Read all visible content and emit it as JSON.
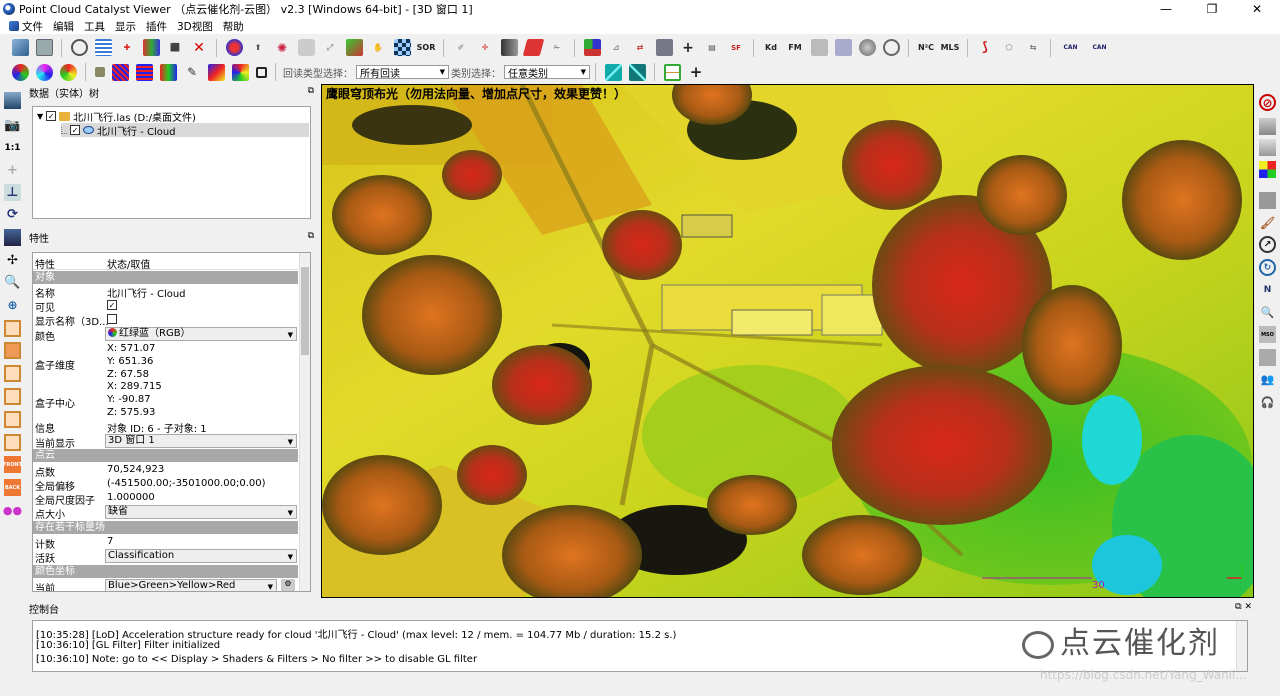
{
  "window": {
    "title": "Point Cloud Catalyst Viewer （点云催化剂-云图） v2.3 [Windows 64-bit] - [3D 窗口 1]",
    "min": "—",
    "max": "❐",
    "close": "✕"
  },
  "menu": [
    "文件",
    "编辑",
    "工具",
    "显示",
    "插件",
    "3D视图",
    "帮助"
  ],
  "toolbar2": {
    "filter_label": "回读类型选择：",
    "filter_value": "所有回读",
    "class_label": "类别选择：",
    "class_value": "任意类别"
  },
  "db_panel": {
    "title": "数据（实体）树",
    "file_item": "北川飞行.las (D:/桌面文件)",
    "cloud_item": "北川飞行 - Cloud"
  },
  "props_panel": {
    "title": "特性",
    "col_property": "特性",
    "col_value": "状态/取值",
    "sec_object": "对象",
    "name_key": "名称",
    "name_val": "北川飞行 - Cloud",
    "visible_key": "可见",
    "show_name_key": "显示名称（3D...",
    "color_key": "颜色",
    "color_val": "红绿蓝（RGB）",
    "bbox_dim_key": "盒子维度",
    "bbox_dim_x": "X: 571.07",
    "bbox_dim_y": "Y: 651.36",
    "bbox_dim_z": "Z: 67.58",
    "bbox_center_key": "盒子中心",
    "bbox_center_x": "X: 289.715",
    "bbox_center_y": "Y: -90.87",
    "bbox_center_z": "Z: 575.93",
    "info_key": "信息",
    "info_val": "对象 ID: 6 - 子对象: 1",
    "current_display_key": "当前显示",
    "current_display_val": "3D 窗口 1",
    "sec_cloud": "点云",
    "points_key": "点数",
    "points_val": "70,524,923",
    "shift_key": "全局偏移",
    "shift_val": "(-451500.00;-3501000.00;0.00)",
    "scale_key": "全局尺度因子",
    "scale_val": "1.000000",
    "point_size_key": "点大小",
    "point_size_val": "缺省",
    "sec_sf": "存在若干标量场",
    "count_key": "计数",
    "count_val": "7",
    "active_key": "活跃",
    "active_val": "Classification",
    "sec_colorscale": "颜色坐标",
    "current_key": "当前",
    "current_val": "Blue>Green>Yellow>Red"
  },
  "view": {
    "message": "鹰眼穹顶布光（勿用法向量、增加点尺寸，效果更赞！）",
    "scale_label": "30"
  },
  "console": {
    "title": "控制台",
    "lines": [
      "[10:35:28] [LoD] Acceleration structure ready for cloud '北川飞行 - Cloud' (max level: 12 / mem. = 104.77 Mb / duration: 15.2 s.)",
      "[10:36:10] [GL Filter] Filter initialized",
      "[10:36:10] Note: go to << Display > Shaders & Filters > No filter >> to disable GL filter"
    ]
  },
  "watermark": {
    "text": "点云催化剂",
    "url": "https://blog.csdn.net/Yang_Wanli..."
  },
  "colors": {
    "red": "#c8231a",
    "orange": "#e07a22",
    "yellow": "#e8df1a",
    "green": "#58c218",
    "cyan": "#22d6d6"
  }
}
